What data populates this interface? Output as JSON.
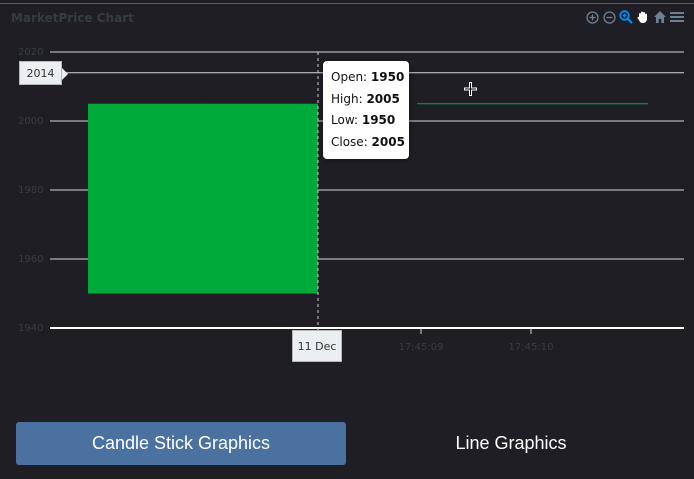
{
  "chart": {
    "title": "MarketPrice Chart"
  },
  "toolbar": {
    "icons": [
      "zoom-in-icon",
      "zoom-out-icon",
      "zoom-select-icon",
      "pan-icon",
      "home-icon",
      "menu-icon"
    ]
  },
  "colors": {
    "background": "#1e1e24",
    "candle": "#00aa3a",
    "grid": "#d8d8d8",
    "tick_text": "#373d3f",
    "button_active": "#4a71a0"
  },
  "chart_data": {
    "type": "candlestick",
    "title": "",
    "ylim": [
      1940,
      2020
    ],
    "yticks": [
      "2020",
      "2000",
      "1980",
      "1960",
      "1940"
    ],
    "xticks": [
      "17:45:09",
      "17:45:10"
    ],
    "candles": [
      {
        "open": 1950,
        "high": 2005,
        "low": 1950,
        "close": 2005
      }
    ],
    "line_series": {
      "value": 2005
    },
    "crosshair": {
      "x_label": "11 Dec",
      "y_label": "2014"
    },
    "tooltip": {
      "open_label": "Open: ",
      "open_value": "1950",
      "high_label": "High: ",
      "high_value": "2005",
      "low_label": "Low: ",
      "low_value": "1950",
      "close_label": "Close: ",
      "close_value": "2005"
    }
  },
  "buttons": {
    "candle_label": "Candle Stick Graphics",
    "line_label": "Line Graphics"
  }
}
